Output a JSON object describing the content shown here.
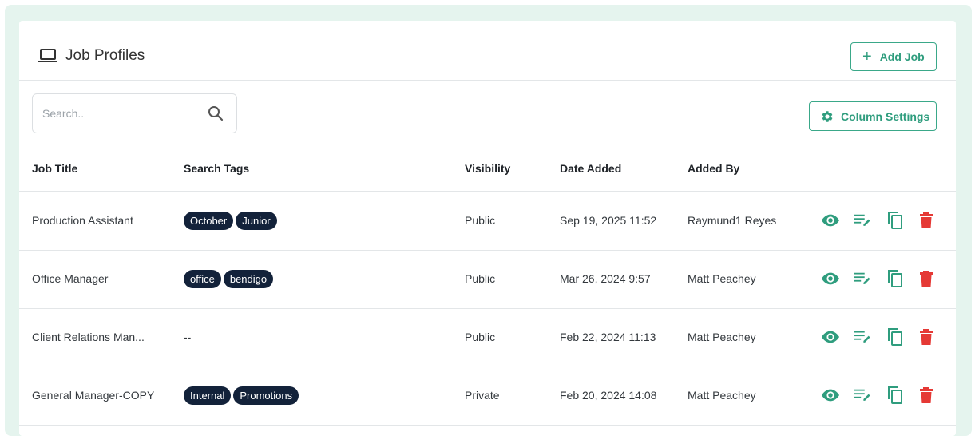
{
  "header": {
    "title": "Job Profiles",
    "title_icon": "laptop-icon",
    "add_job_label": "Add Job"
  },
  "toolbar": {
    "search_placeholder": "Search..",
    "column_settings_label": "Column Settings"
  },
  "table": {
    "columns": [
      "Job Title",
      "Search Tags",
      "Visibility",
      "Date Added",
      "Added By"
    ],
    "rows": [
      {
        "title": "Production Assistant",
        "tags": [
          "October",
          "Junior"
        ],
        "tags_text": "",
        "visibility": "Public",
        "date": "Sep 19, 2025 11:52",
        "added_by": "Raymund1 Reyes"
      },
      {
        "title": "Office Manager",
        "tags": [
          "office",
          "bendigo"
        ],
        "tags_text": "",
        "visibility": "Public",
        "date": "Mar 26, 2024 9:57",
        "added_by": "Matt Peachey"
      },
      {
        "title": "Client Relations Man...",
        "tags": [],
        "tags_text": "--",
        "visibility": "Public",
        "date": "Feb 22, 2024 11:13",
        "added_by": "Matt Peachey"
      },
      {
        "title": "General Manager-COPY",
        "tags": [
          "Internal",
          "Promotions"
        ],
        "tags_text": "",
        "visibility": "Private",
        "date": "Feb 20, 2024 14:08",
        "added_by": "Matt Peachey"
      }
    ],
    "row_actions": [
      "eye-icon",
      "edit-notes-icon",
      "copy-icon",
      "delete-icon"
    ]
  },
  "colors": {
    "accent": "#2f9d7e",
    "danger": "#e53935",
    "tag_bg": "#13223a",
    "page_bg": "#e5f4ee"
  }
}
